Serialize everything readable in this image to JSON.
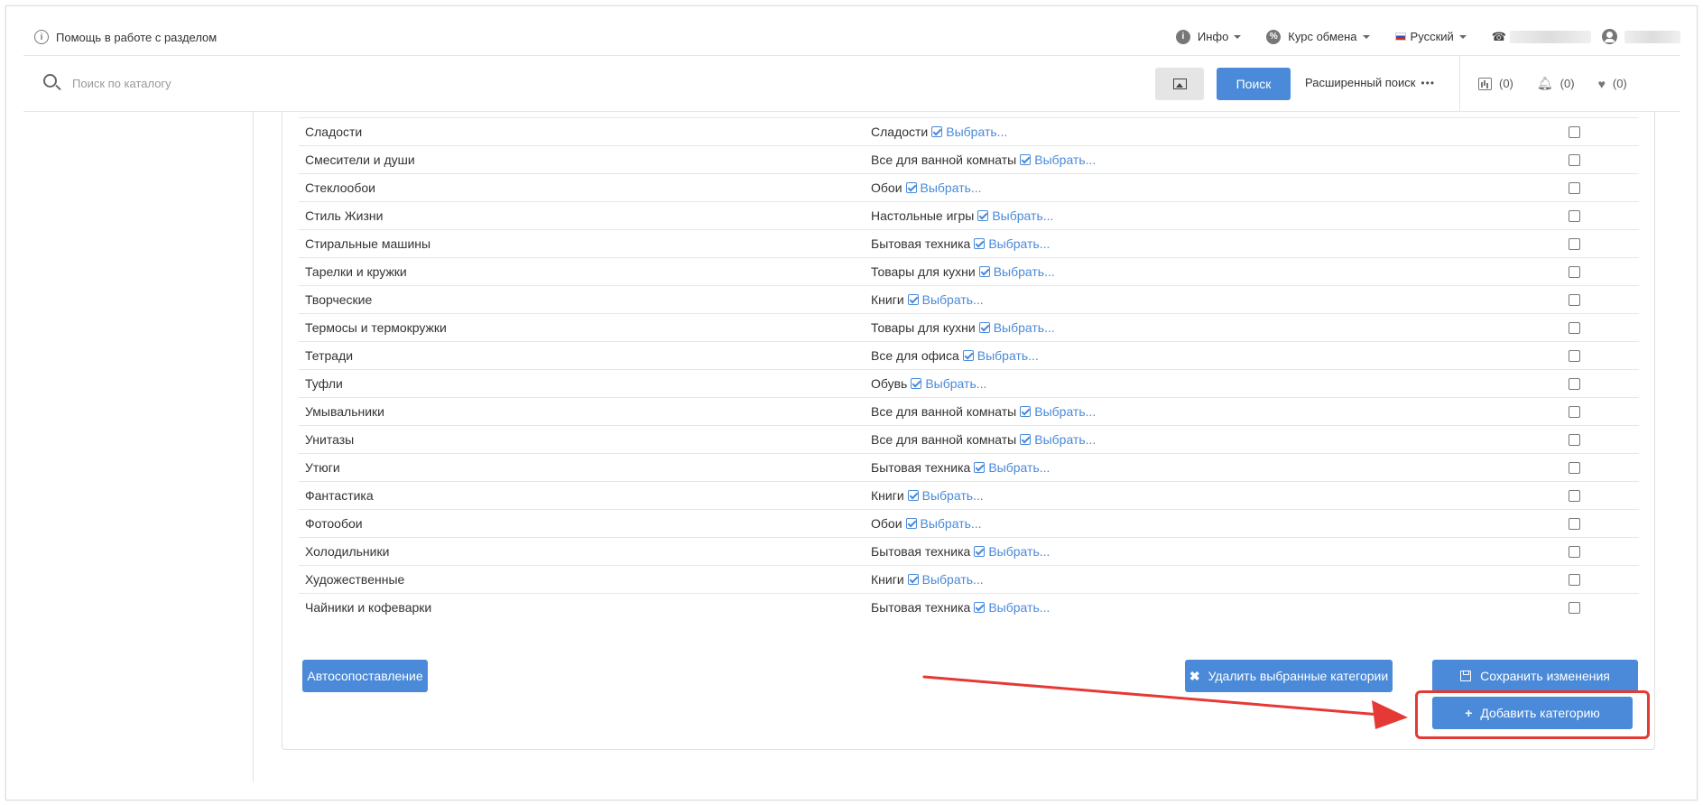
{
  "topbar": {
    "help_text": "Помощь в работе с разделом",
    "info_label": "Инфо",
    "exchange_label": "Курс обмена",
    "language_label": "Русский"
  },
  "search": {
    "placeholder": "Поиск по каталогу",
    "button_label": "Поиск",
    "advanced_label": "Расширенный поиск",
    "advanced_dots": "•••"
  },
  "counters": {
    "compare": "(0)",
    "notifications": "(0)",
    "favorites": "(0)"
  },
  "table": {
    "choose_label": "Выбрать...",
    "rows": [
      {
        "name": "Сладости",
        "mapped": "Сладости"
      },
      {
        "name": "Смесители и души",
        "mapped": "Все для ванной комнаты"
      },
      {
        "name": "Стеклообои",
        "mapped": "Обои"
      },
      {
        "name": "Стиль Жизни",
        "mapped": "Настольные игры"
      },
      {
        "name": "Стиральные машины",
        "mapped": "Бытовая техника"
      },
      {
        "name": "Тарелки и кружки",
        "mapped": "Товары для кухни"
      },
      {
        "name": "Творческие",
        "mapped": "Книги"
      },
      {
        "name": "Термосы и термокружки",
        "mapped": "Товары для кухни"
      },
      {
        "name": "Тетради",
        "mapped": "Все для офиса"
      },
      {
        "name": "Туфли",
        "mapped": "Обувь"
      },
      {
        "name": "Умывальники",
        "mapped": "Все для ванной комнаты"
      },
      {
        "name": "Унитазы",
        "mapped": "Все для ванной комнаты"
      },
      {
        "name": "Утюги",
        "mapped": "Бытовая техника"
      },
      {
        "name": "Фантастика",
        "mapped": "Книги"
      },
      {
        "name": "Фотообои",
        "mapped": "Обои"
      },
      {
        "name": "Холодильники",
        "mapped": "Бытовая техника"
      },
      {
        "name": "Художественные",
        "mapped": "Книги"
      },
      {
        "name": "Чайники и кофеварки",
        "mapped": "Бытовая техника"
      }
    ]
  },
  "actions": {
    "auto_match": "Автосопоставление",
    "delete_selected": "Удалить выбранные категории",
    "save_changes": "Сохранить изменения",
    "add_category": "Добавить категорию"
  },
  "colors": {
    "accent": "#4a8ad8",
    "annotation": "#e53935"
  }
}
